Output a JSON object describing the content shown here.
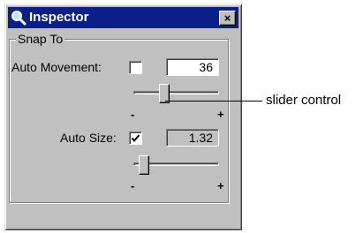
{
  "window": {
    "title": "Inspector",
    "close_label": "×"
  },
  "group": {
    "label": "Snap To"
  },
  "auto_movement": {
    "label": "Auto Movement:",
    "checked": false,
    "value": "36",
    "slider_min": "-",
    "slider_max": "+"
  },
  "auto_size": {
    "label": "Auto Size:",
    "checked": true,
    "value": "1.32",
    "slider_min": "-",
    "slider_max": "+"
  },
  "callout": {
    "text": "slider control"
  },
  "colors": {
    "titlebar": "#0a1f8a",
    "face": "#c0c0c0"
  }
}
